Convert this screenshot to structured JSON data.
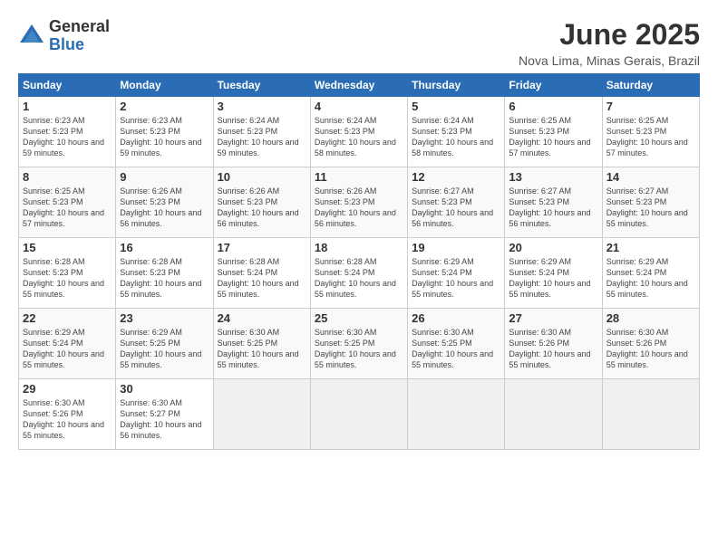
{
  "logo": {
    "general": "General",
    "blue": "Blue"
  },
  "title": "June 2025",
  "subtitle": "Nova Lima, Minas Gerais, Brazil",
  "days_of_week": [
    "Sunday",
    "Monday",
    "Tuesday",
    "Wednesday",
    "Thursday",
    "Friday",
    "Saturday"
  ],
  "weeks": [
    [
      {
        "day": "1",
        "sunrise": "6:23 AM",
        "sunset": "5:23 PM",
        "daylight": "10 hours and 59 minutes."
      },
      {
        "day": "2",
        "sunrise": "6:23 AM",
        "sunset": "5:23 PM",
        "daylight": "10 hours and 59 minutes."
      },
      {
        "day": "3",
        "sunrise": "6:24 AM",
        "sunset": "5:23 PM",
        "daylight": "10 hours and 59 minutes."
      },
      {
        "day": "4",
        "sunrise": "6:24 AM",
        "sunset": "5:23 PM",
        "daylight": "10 hours and 58 minutes."
      },
      {
        "day": "5",
        "sunrise": "6:24 AM",
        "sunset": "5:23 PM",
        "daylight": "10 hours and 58 minutes."
      },
      {
        "day": "6",
        "sunrise": "6:25 AM",
        "sunset": "5:23 PM",
        "daylight": "10 hours and 57 minutes."
      },
      {
        "day": "7",
        "sunrise": "6:25 AM",
        "sunset": "5:23 PM",
        "daylight": "10 hours and 57 minutes."
      }
    ],
    [
      {
        "day": "8",
        "sunrise": "6:25 AM",
        "sunset": "5:23 PM",
        "daylight": "10 hours and 57 minutes."
      },
      {
        "day": "9",
        "sunrise": "6:26 AM",
        "sunset": "5:23 PM",
        "daylight": "10 hours and 56 minutes."
      },
      {
        "day": "10",
        "sunrise": "6:26 AM",
        "sunset": "5:23 PM",
        "daylight": "10 hours and 56 minutes."
      },
      {
        "day": "11",
        "sunrise": "6:26 AM",
        "sunset": "5:23 PM",
        "daylight": "10 hours and 56 minutes."
      },
      {
        "day": "12",
        "sunrise": "6:27 AM",
        "sunset": "5:23 PM",
        "daylight": "10 hours and 56 minutes."
      },
      {
        "day": "13",
        "sunrise": "6:27 AM",
        "sunset": "5:23 PM",
        "daylight": "10 hours and 56 minutes."
      },
      {
        "day": "14",
        "sunrise": "6:27 AM",
        "sunset": "5:23 PM",
        "daylight": "10 hours and 55 minutes."
      }
    ],
    [
      {
        "day": "15",
        "sunrise": "6:28 AM",
        "sunset": "5:23 PM",
        "daylight": "10 hours and 55 minutes."
      },
      {
        "day": "16",
        "sunrise": "6:28 AM",
        "sunset": "5:23 PM",
        "daylight": "10 hours and 55 minutes."
      },
      {
        "day": "17",
        "sunrise": "6:28 AM",
        "sunset": "5:24 PM",
        "daylight": "10 hours and 55 minutes."
      },
      {
        "day": "18",
        "sunrise": "6:28 AM",
        "sunset": "5:24 PM",
        "daylight": "10 hours and 55 minutes."
      },
      {
        "day": "19",
        "sunrise": "6:29 AM",
        "sunset": "5:24 PM",
        "daylight": "10 hours and 55 minutes."
      },
      {
        "day": "20",
        "sunrise": "6:29 AM",
        "sunset": "5:24 PM",
        "daylight": "10 hours and 55 minutes."
      },
      {
        "day": "21",
        "sunrise": "6:29 AM",
        "sunset": "5:24 PM",
        "daylight": "10 hours and 55 minutes."
      }
    ],
    [
      {
        "day": "22",
        "sunrise": "6:29 AM",
        "sunset": "5:24 PM",
        "daylight": "10 hours and 55 minutes."
      },
      {
        "day": "23",
        "sunrise": "6:29 AM",
        "sunset": "5:25 PM",
        "daylight": "10 hours and 55 minutes."
      },
      {
        "day": "24",
        "sunrise": "6:30 AM",
        "sunset": "5:25 PM",
        "daylight": "10 hours and 55 minutes."
      },
      {
        "day": "25",
        "sunrise": "6:30 AM",
        "sunset": "5:25 PM",
        "daylight": "10 hours and 55 minutes."
      },
      {
        "day": "26",
        "sunrise": "6:30 AM",
        "sunset": "5:25 PM",
        "daylight": "10 hours and 55 minutes."
      },
      {
        "day": "27",
        "sunrise": "6:30 AM",
        "sunset": "5:26 PM",
        "daylight": "10 hours and 55 minutes."
      },
      {
        "day": "28",
        "sunrise": "6:30 AM",
        "sunset": "5:26 PM",
        "daylight": "10 hours and 55 minutes."
      }
    ],
    [
      {
        "day": "29",
        "sunrise": "6:30 AM",
        "sunset": "5:26 PM",
        "daylight": "10 hours and 55 minutes."
      },
      {
        "day": "30",
        "sunrise": "6:30 AM",
        "sunset": "5:27 PM",
        "daylight": "10 hours and 56 minutes."
      },
      {
        "day": "",
        "sunrise": "",
        "sunset": "",
        "daylight": ""
      },
      {
        "day": "",
        "sunrise": "",
        "sunset": "",
        "daylight": ""
      },
      {
        "day": "",
        "sunrise": "",
        "sunset": "",
        "daylight": ""
      },
      {
        "day": "",
        "sunrise": "",
        "sunset": "",
        "daylight": ""
      },
      {
        "day": "",
        "sunrise": "",
        "sunset": "",
        "daylight": ""
      }
    ]
  ]
}
